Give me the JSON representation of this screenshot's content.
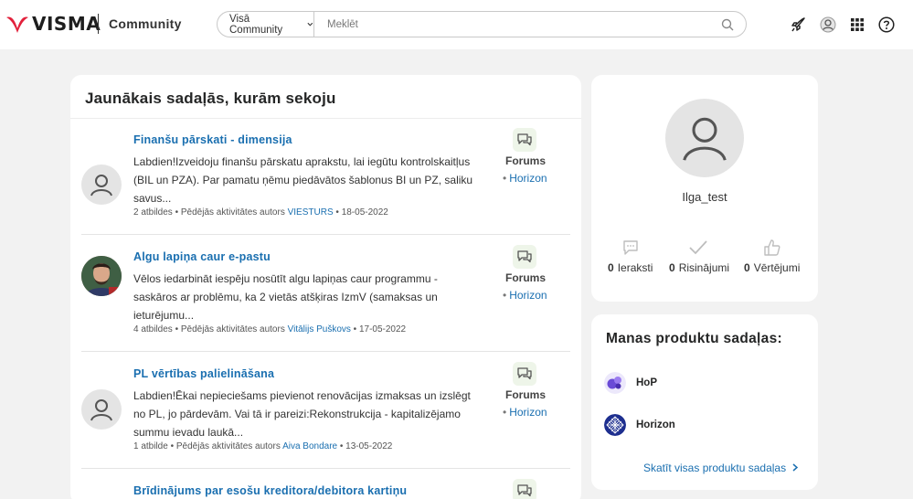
{
  "header": {
    "logo_text": "VISMA",
    "community_label": "Community",
    "search_scope": "Visā Community",
    "search_placeholder": "Meklēt"
  },
  "feed": {
    "title": "Jaunākais sadaļās, kurām sekoju",
    "items": [
      {
        "title": "Finanšu pārskati - dimensija",
        "body": "Labdien!Izveidoju finanšu pārskatu aprakstu, lai iegūtu kontrolskaitļus (BIL un PZA). Par pamatu ņēmu piedāvātos šablonus BI un PZ, saliku savus...",
        "replies": "2 atbildes",
        "last_activity_label": "Pēdējās aktivitātes autors",
        "author": "VIESTURS",
        "date": "18-05-2022",
        "board_type": "Forums",
        "board": "Horizon"
      },
      {
        "title": "Algu lapiņa caur e-pastu",
        "body": "Vēlos iedarbināt iespēju nosūtīt algu lapiņas caur programmu - saskāros ar problēmu, ka 2 vietās atšķiras IzmV (samaksas un ieturējumu...",
        "replies": "4 atbildes",
        "last_activity_label": "Pēdējās aktivitātes autors",
        "author": "Vitālijs Puškovs",
        "date": "17-05-2022",
        "board_type": "Forums",
        "board": "Horizon"
      },
      {
        "title": "PL vērtības palielināšana",
        "body": "Labdien!Ēkai nepieciešams pievienot renovācijas izmaksas un izslēgt no PL, jo pārdevām. Vai tā ir pareizi:Rekonstrukcija - kapitalizējamo summu ievadu laukā...",
        "replies": "1 atbilde",
        "last_activity_label": "Pēdējās aktivitātes autors",
        "author": "Aiva Bondare",
        "date": "13-05-2022",
        "board_type": "Forums",
        "board": "Horizon"
      },
      {
        "title": "Brīdinājums par esošu kreditora/debitora kartiņu",
        "body": "",
        "replies": "",
        "last_activity_label": "",
        "author": "",
        "date": "",
        "board_type": "",
        "board": ""
      }
    ]
  },
  "profile": {
    "name": "Ilga_test",
    "stats": [
      {
        "count": "0",
        "label": "Ieraksti",
        "icon": "comment-icon"
      },
      {
        "count": "0",
        "label": "Risinājumi",
        "icon": "checkmark-icon"
      },
      {
        "count": "0",
        "label": "Vērtējumi",
        "icon": "thumbs-up-icon"
      }
    ]
  },
  "products": {
    "title": "Manas produktu sadaļas:",
    "items": [
      {
        "name": "HoP",
        "icon": "hop-product-icon",
        "color": "#6a4bd6"
      },
      {
        "name": "Horizon",
        "icon": "horizon-product-icon",
        "color": "#1e2f8f"
      }
    ],
    "link": "Skatīt visas produktu sadaļas"
  },
  "colors": {
    "brand_red": "#e2203b",
    "link_blue": "#1a6fb0",
    "forum_icon_bg": "#eef5e9"
  }
}
